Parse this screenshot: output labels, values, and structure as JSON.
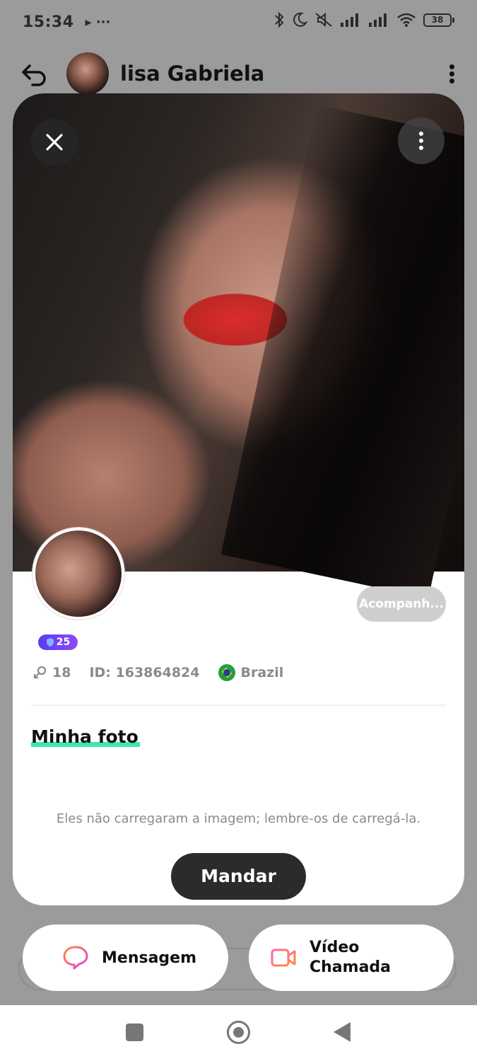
{
  "status_bar": {
    "time": "15:34",
    "extra_indicators": "▸ ···",
    "battery": "38",
    "icons": [
      "bluetooth-icon",
      "moon-icon",
      "mute-icon",
      "signal-icon",
      "signal-icon",
      "wifi-icon",
      "battery-icon"
    ]
  },
  "chat_header": {
    "name": "lisa Gabriela"
  },
  "profile": {
    "follow_label": "Acompanh...",
    "level": "25",
    "fans_count": "18",
    "id_text": "ID: 163864824",
    "country": "Brazil",
    "section_title": "Minha foto",
    "empty_note": "Eles não carregaram a imagem; lembre-os de carregá-la.",
    "send_label": "Mandar"
  },
  "actions": {
    "message_label": "Mensagem",
    "video_label_line1": "Vídeo",
    "video_label_line2": "Chamada"
  },
  "colors": {
    "accent_green": "#3ce8a8",
    "level_badge": "#6a44f4",
    "dark_button": "#2b2b2b",
    "overlay_gray": "#9b9b9b"
  }
}
